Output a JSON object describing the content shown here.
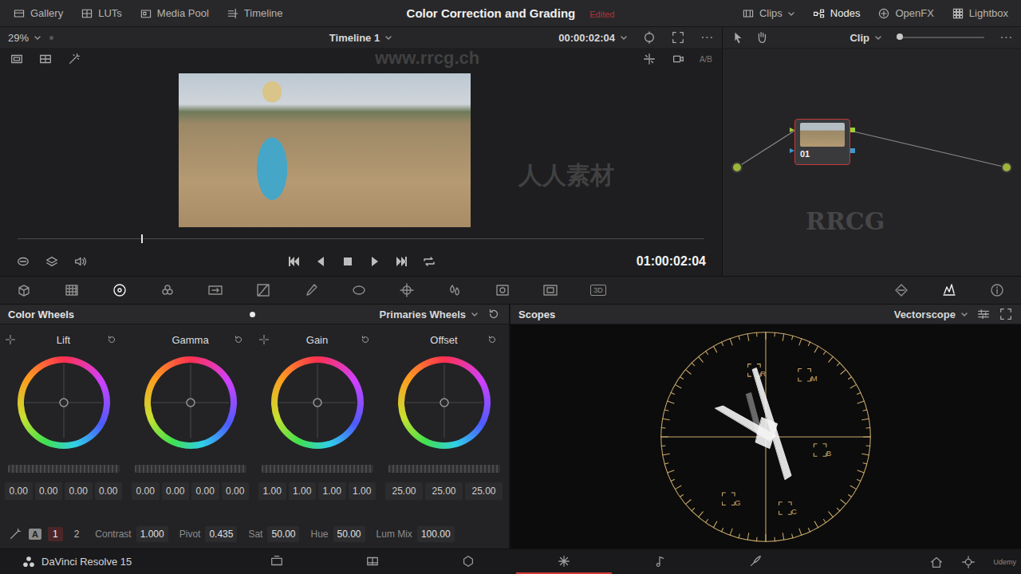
{
  "topbar": {
    "left": [
      {
        "label": "Gallery",
        "selected": false
      },
      {
        "label": "LUTs",
        "selected": false
      },
      {
        "label": "Media Pool",
        "selected": false
      },
      {
        "label": "Timeline",
        "selected": false
      }
    ],
    "title": "Color Correction and Grading",
    "status": "Edited",
    "right": [
      {
        "label": "Clips",
        "selected": false,
        "dropdown": true
      },
      {
        "label": "Nodes",
        "selected": true,
        "dropdown": false
      },
      {
        "label": "OpenFX",
        "selected": false,
        "dropdown": false
      },
      {
        "label": "Lightbox",
        "selected": false,
        "dropdown": false
      }
    ]
  },
  "viewer": {
    "zoom": "29%",
    "timeline": "Timeline 1",
    "timecode": "00:00:02:04",
    "compare": "A/B",
    "playhead": 0.18,
    "current_time": "01:00:02:04"
  },
  "node_editor": {
    "mode": "Clip",
    "zoom": 0.0,
    "nodes": [
      {
        "label": "01",
        "selected": true
      }
    ]
  },
  "tools": {
    "left": [
      {
        "label": "",
        "selected": false
      },
      {
        "label": "",
        "selected": false
      },
      {
        "label": "",
        "selected": true
      },
      {
        "label": "",
        "selected": false
      },
      {
        "label": "",
        "selected": false
      },
      {
        "label": "",
        "selected": false
      },
      {
        "label": "",
        "selected": false
      },
      {
        "label": "",
        "selected": false
      },
      {
        "label": "",
        "selected": false
      },
      {
        "label": "",
        "selected": false
      },
      {
        "label": "",
        "selected": false
      },
      {
        "label": "",
        "selected": false
      },
      {
        "label": "3D",
        "selected": false
      }
    ],
    "right": [
      {
        "selected": false
      },
      {
        "selected": true
      },
      {
        "selected": false
      }
    ]
  },
  "color_wheels": {
    "title": "Color Wheels",
    "mode": "Primaries Wheels",
    "wheels": [
      {
        "label": "Lift",
        "picker": true,
        "values": [
          "0.00",
          "0.00",
          "0.00",
          "0.00"
        ]
      },
      {
        "label": "Gamma",
        "picker": false,
        "values": [
          "0.00",
          "0.00",
          "0.00",
          "0.00"
        ]
      },
      {
        "label": "Gain",
        "picker": true,
        "values": [
          "1.00",
          "1.00",
          "1.00",
          "1.00"
        ]
      },
      {
        "label": "Offset",
        "picker": false,
        "values": [
          "25.00",
          "25.00",
          "25.00"
        ]
      }
    ],
    "auto_label": "A",
    "pages": [
      {
        "label": "1",
        "selected": true
      },
      {
        "label": "2",
        "selected": false
      }
    ],
    "params": [
      {
        "label": "Contrast",
        "value": "1.000"
      },
      {
        "label": "Pivot",
        "value": "0.435"
      },
      {
        "label": "Sat",
        "value": "50.00"
      },
      {
        "label": "Hue",
        "value": "50.00"
      },
      {
        "label": "Lum Mix",
        "value": "100.00"
      }
    ]
  },
  "scopes": {
    "title": "Scopes",
    "type": "Vectorscope",
    "targets": [
      {
        "label": "R"
      },
      {
        "label": "M"
      },
      {
        "label": "B"
      },
      {
        "label": "C"
      },
      {
        "label": "G"
      }
    ]
  },
  "footer": {
    "app": "DaVinci Resolve 15",
    "brand": "Udemy",
    "pages": [
      {
        "selected": false
      },
      {
        "selected": false
      },
      {
        "selected": false
      },
      {
        "selected": true
      },
      {
        "selected": false
      },
      {
        "selected": false
      }
    ]
  },
  "watermarks": [
    {
      "text": "www.rrcg.ch"
    },
    {
      "text": "RRCG"
    },
    {
      "text": "人人素材"
    }
  ]
}
